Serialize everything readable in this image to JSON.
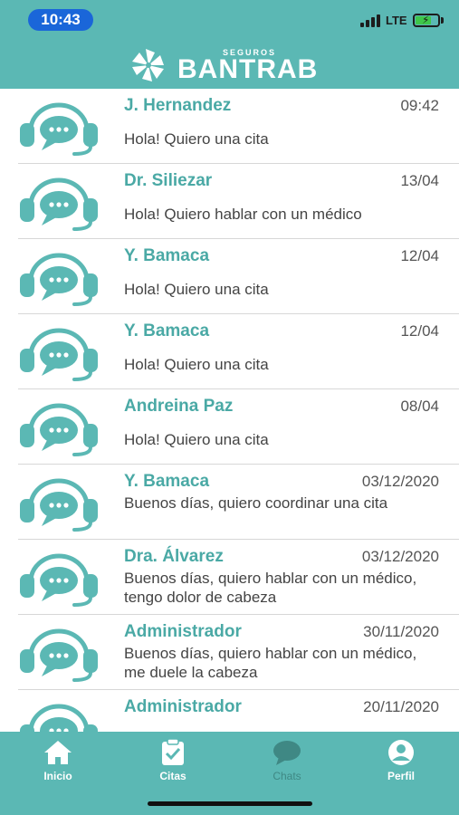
{
  "status_bar": {
    "time": "10:43",
    "network": "LTE"
  },
  "brand": {
    "small": "SEGUROS",
    "name": "BANTRAB",
    "color": "#5bb8b4",
    "accent": "#4aa9a5"
  },
  "chats": [
    {
      "name": "J. Hernandez",
      "date": "09:42",
      "message": "Hola! Quiero una cita",
      "icon": "support-agent-icon"
    },
    {
      "name": "Dr. Siliezar",
      "date": "13/04",
      "message": "Hola! Quiero hablar con un médico",
      "icon": "support-agent-icon"
    },
    {
      "name": "Y. Bamaca",
      "date": "12/04",
      "message": "Hola! Quiero una cita",
      "icon": "support-agent-icon"
    },
    {
      "name": "Y. Bamaca",
      "date": "12/04",
      "message": "Hola! Quiero una cita",
      "icon": "support-agent-icon"
    },
    {
      "name": "Andreina Paz",
      "date": "08/04",
      "message": "Hola! Quiero una cita",
      "icon": "support-agent-icon"
    },
    {
      "name": "Y. Bamaca",
      "date": "03/12/2020",
      "message": "Buenos días, quiero coordinar una cita",
      "icon": "support-agent-icon"
    },
    {
      "name": "Dra. Álvarez",
      "date": "03/12/2020",
      "message": "Buenos días, quiero hablar con un médico, tengo dolor de cabeza",
      "icon": "support-agent-icon"
    },
    {
      "name": "Administrador",
      "date": "30/11/2020",
      "message": "Buenos días, quiero hablar con un médico, me duele la cabeza",
      "icon": "support-agent-icon"
    },
    {
      "name": "Administrador",
      "date": "20/11/2020",
      "message": "",
      "icon": "support-agent-icon"
    }
  ],
  "tabs": [
    {
      "label": "Inicio",
      "icon": "home-icon",
      "active": true
    },
    {
      "label": "Citas",
      "icon": "clipboard-check-icon",
      "active": true
    },
    {
      "label": "Chats",
      "icon": "chat-bubble-icon",
      "active": false
    },
    {
      "label": "Perfil",
      "icon": "user-circle-icon",
      "active": true
    }
  ]
}
